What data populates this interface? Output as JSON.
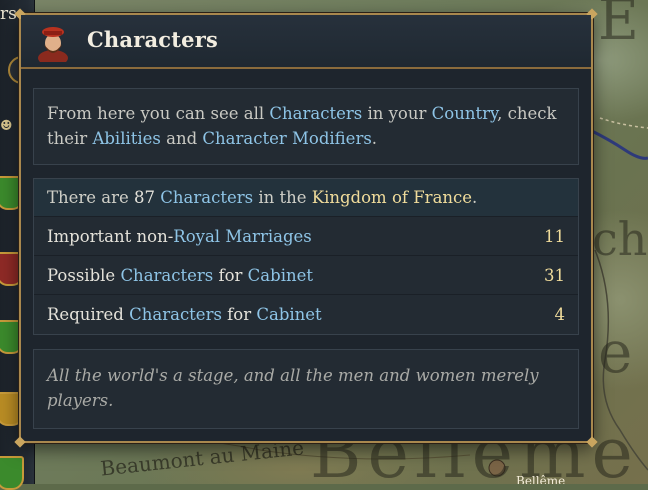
{
  "window": {
    "title": "Characters"
  },
  "description": {
    "t1": "From here you can see all ",
    "k1": "Characters",
    "t2": " in your ",
    "k2": "Country",
    "t3": ", check their ",
    "k3": "Abilities",
    "t4": " and ",
    "k4": "Character Modifiers",
    "t5": "."
  },
  "summary": {
    "t1": "There are ",
    "count": "87",
    "t2": " ",
    "k1": "Characters",
    "t3": " in the ",
    "country": "Kingdom of France",
    "t4": "."
  },
  "rows": [
    {
      "pre": "Important non-",
      "kw": "Royal Marriages",
      "mid": "",
      "kw2": "",
      "value": "11"
    },
    {
      "pre": "Possible ",
      "kw": "Characters",
      "mid": " for ",
      "kw2": "Cabinet",
      "value": "31"
    },
    {
      "pre": "Required ",
      "kw": "Characters",
      "mid": " for ",
      "kw2": "Cabinet",
      "value": "4"
    }
  ],
  "quote": "All the world's a stage, and all the men and women merely players.",
  "map_labels": {
    "top_right": "E",
    "right_mid": "ch",
    "right_low": "e",
    "bottom_big": "Bellême",
    "bottom_small": "Beaumont au Maine",
    "bottom_city": "Bellême",
    "left_fragment": "rs"
  },
  "icons": {
    "portrait": "character-portrait-icon",
    "mask": "theater-mask-icon"
  },
  "colors": {
    "keyword": "#8ec4e6",
    "highlight": "#f0dc9b",
    "border": "#a9884e",
    "panel_bg": "#1e252d"
  }
}
